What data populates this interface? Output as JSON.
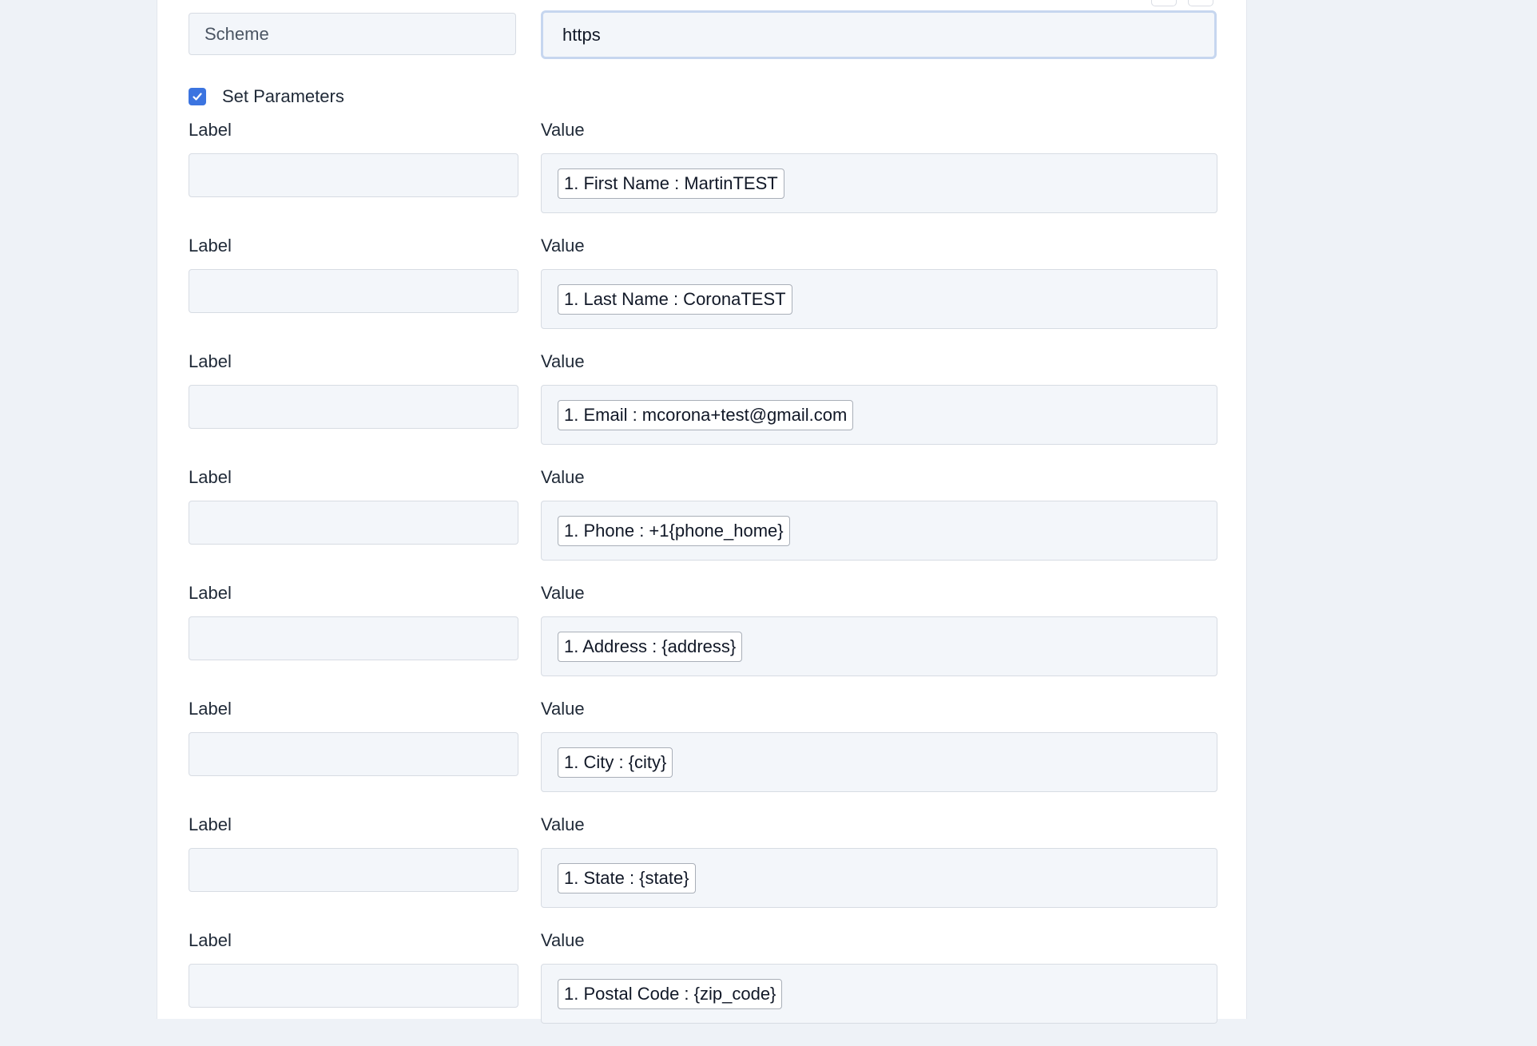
{
  "scheme": {
    "label": "Scheme",
    "value": "https"
  },
  "set_parameters": {
    "label": "Set Parameters",
    "checked": true
  },
  "colors": {
    "accent": "#3b74e0",
    "field_bg": "#f3f6fa",
    "page_bg": "#eef2f7"
  },
  "parameters": [
    {
      "label_title": "Label",
      "value_title": "Value",
      "label_value": "",
      "tag": "1. First Name : MartinTEST"
    },
    {
      "label_title": "Label",
      "value_title": "Value",
      "label_value": "",
      "tag": "1. Last Name : CoronaTEST"
    },
    {
      "label_title": "Label",
      "value_title": "Value",
      "label_value": "",
      "tag": "1. Email : mcorona+test@gmail.com"
    },
    {
      "label_title": "Label",
      "value_title": "Value",
      "label_value": "",
      "tag": "1. Phone : +1{phone_home}"
    },
    {
      "label_title": "Label",
      "value_title": "Value",
      "label_value": "",
      "tag": "1. Address : {address}"
    },
    {
      "label_title": "Label",
      "value_title": "Value",
      "label_value": "",
      "tag": "1. City : {city}"
    },
    {
      "label_title": "Label",
      "value_title": "Value",
      "label_value": "",
      "tag": "1. State : {state}"
    },
    {
      "label_title": "Label",
      "value_title": "Value",
      "label_value": "",
      "tag": "1. Postal Code : {zip_code}"
    }
  ]
}
